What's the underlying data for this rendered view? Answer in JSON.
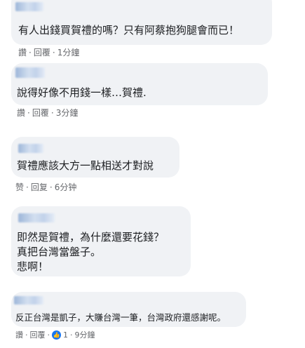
{
  "comments": [
    {
      "text_lines": [
        "有人出錢買賀禮的嗎？只有阿蔡抱狗腿會而已！"
      ],
      "actions": {
        "like": "讚",
        "sep": "·",
        "reply": "回覆",
        "time": "1分鐘"
      }
    },
    {
      "text_lines": [
        "說得好像不用錢一樣…賀禮."
      ],
      "actions": {
        "like": "讚",
        "sep": "·",
        "reply": "回覆",
        "time": "3分鐘"
      }
    },
    {
      "text_lines": [
        "賀禮應該大方一點相送才對說"
      ],
      "actions": {
        "like": "赞",
        "sep": "·",
        "reply": "回复",
        "time": "6分钟"
      }
    },
    {
      "text_lines": [
        "即然是賀禮，為什麼還要花錢？",
        "真把台灣當盤子。",
        "悲啊！"
      ],
      "actions": {}
    },
    {
      "text_lines": [
        "反正台灣是凱子，大賺台灣一筆，台灣政府還感謝呢。"
      ],
      "actions": {
        "like": "讚",
        "sep": "·",
        "reply": "回覆",
        "reaction_count": "1",
        "time": "9分鐘"
      }
    }
  ],
  "colors": {
    "bubble": "#f0f2f5",
    "action_text": "#65676b",
    "like_reaction": "#1877f2"
  },
  "icons": {
    "reaction": "thumbs-up-icon"
  }
}
